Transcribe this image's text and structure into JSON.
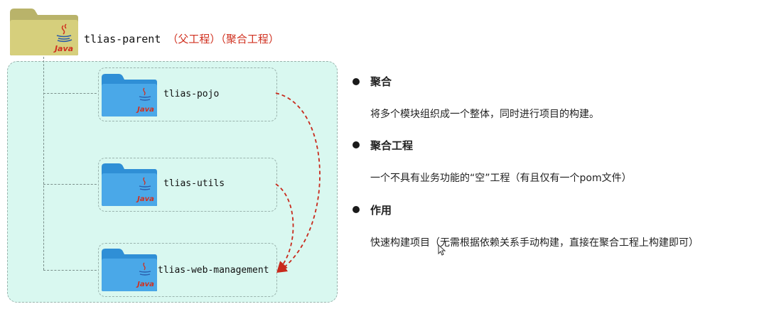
{
  "parent": {
    "name": "tlias-parent",
    "note": "（父工程）（聚合工程）",
    "folder_label": "Java"
  },
  "modules": [
    {
      "name": "tlias-pojo",
      "folder_label": "Java"
    },
    {
      "name": "tlias-utils",
      "folder_label": "Java"
    },
    {
      "name": "tlias-web-management",
      "folder_label": "Java"
    }
  ],
  "bullets": [
    {
      "title": "聚合",
      "text": "将多个模块组织成一个整体，同时进行项目的构建。"
    },
    {
      "title": "聚合工程",
      "text": "一个不具有业务功能的“空”工程（有且仅有一个pom文件）"
    },
    {
      "title": "作用",
      "text": "快速构建项目（无需根据依赖关系手动构建，直接在聚合工程上构建即可）"
    }
  ],
  "colors": {
    "panel_bg": "#d9f8f0",
    "parent_folder": "#d6cf7c",
    "module_folder": "#4aa8e8",
    "arrow": "#c82a1c",
    "note_red": "#d0301f"
  }
}
